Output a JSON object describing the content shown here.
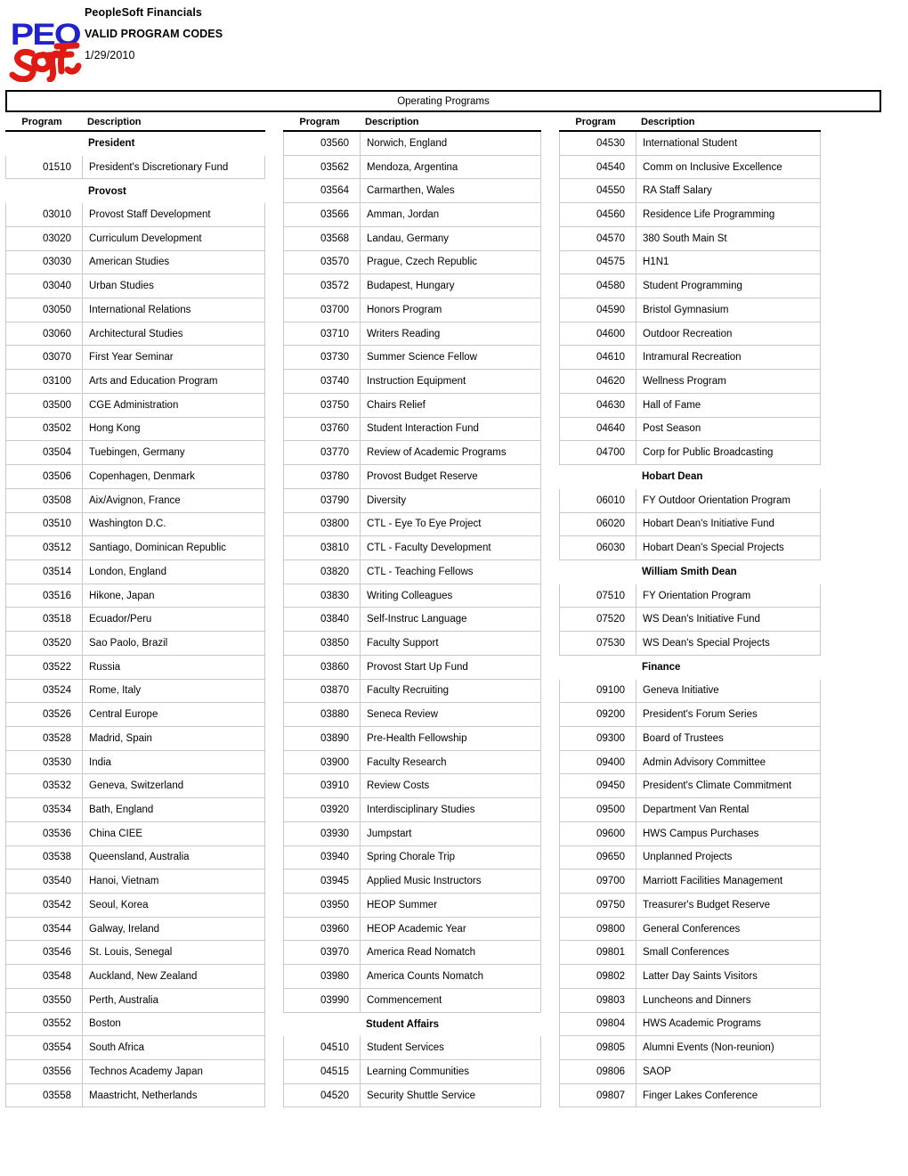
{
  "header": {
    "logo_top_text": "PEOPLE",
    "logo_script_text": "Soft",
    "app_title": "PeopleSoft Financials",
    "report_title": "VALID PROGRAM CODES",
    "report_date": "1/29/2010"
  },
  "table": {
    "title": "Operating Programs",
    "column_headers": {
      "program": "Program",
      "description": "Description"
    },
    "columns": [
      {
        "rows": [
          {
            "type": "section",
            "program": "",
            "description": "President"
          },
          {
            "type": "data",
            "program": "01510",
            "description": "President's Discretionary Fund"
          },
          {
            "type": "section",
            "program": "",
            "description": "Provost"
          },
          {
            "type": "data",
            "program": "03010",
            "description": "Provost Staff Development"
          },
          {
            "type": "data",
            "program": "03020",
            "description": "Curriculum Development"
          },
          {
            "type": "data",
            "program": "03030",
            "description": "American Studies"
          },
          {
            "type": "data",
            "program": "03040",
            "description": "Urban Studies"
          },
          {
            "type": "data",
            "program": "03050",
            "description": "International Relations"
          },
          {
            "type": "data",
            "program": "03060",
            "description": "Architectural Studies"
          },
          {
            "type": "data",
            "program": "03070",
            "description": "First Year Seminar"
          },
          {
            "type": "data",
            "program": "03100",
            "description": "Arts and Education Program"
          },
          {
            "type": "data",
            "program": "03500",
            "description": "CGE Administration"
          },
          {
            "type": "data",
            "program": "03502",
            "description": "Hong Kong"
          },
          {
            "type": "data",
            "program": "03504",
            "description": "Tuebingen, Germany"
          },
          {
            "type": "data",
            "program": "03506",
            "description": "Copenhagen, Denmark"
          },
          {
            "type": "data",
            "program": "03508",
            "description": "Aix/Avignon, France"
          },
          {
            "type": "data",
            "program": "03510",
            "description": "Washington D.C."
          },
          {
            "type": "data",
            "program": "03512",
            "description": "Santiago, Dominican Republic"
          },
          {
            "type": "data",
            "program": "03514",
            "description": "London, England"
          },
          {
            "type": "data",
            "program": "03516",
            "description": "Hikone, Japan"
          },
          {
            "type": "data",
            "program": "03518",
            "description": "Ecuador/Peru"
          },
          {
            "type": "data",
            "program": "03520",
            "description": "Sao Paolo, Brazil"
          },
          {
            "type": "data",
            "program": "03522",
            "description": "Russia"
          },
          {
            "type": "data",
            "program": "03524",
            "description": "Rome, Italy"
          },
          {
            "type": "data",
            "program": "03526",
            "description": "Central Europe"
          },
          {
            "type": "data",
            "program": "03528",
            "description": "Madrid, Spain"
          },
          {
            "type": "data",
            "program": "03530",
            "description": "India"
          },
          {
            "type": "data",
            "program": "03532",
            "description": "Geneva, Switzerland"
          },
          {
            "type": "data",
            "program": "03534",
            "description": "Bath, England"
          },
          {
            "type": "data",
            "program": "03536",
            "description": "China CIEE"
          },
          {
            "type": "data",
            "program": "03538",
            "description": "Queensland, Australia"
          },
          {
            "type": "data",
            "program": "03540",
            "description": "Hanoi, Vietnam"
          },
          {
            "type": "data",
            "program": "03542",
            "description": "Seoul, Korea"
          },
          {
            "type": "data",
            "program": "03544",
            "description": "Galway, Ireland"
          },
          {
            "type": "data",
            "program": "03546",
            "description": "St. Louis, Senegal"
          },
          {
            "type": "data",
            "program": "03548",
            "description": "Auckland, New Zealand"
          },
          {
            "type": "data",
            "program": "03550",
            "description": "Perth, Australia"
          },
          {
            "type": "data",
            "program": "03552",
            "description": "Boston"
          },
          {
            "type": "data",
            "program": "03554",
            "description": "South Africa"
          },
          {
            "type": "data",
            "program": "03556",
            "description": "Technos Academy Japan"
          },
          {
            "type": "data",
            "program": "03558",
            "description": "Maastricht, Netherlands"
          }
        ]
      },
      {
        "rows": [
          {
            "type": "data",
            "program": "03560",
            "description": "Norwich, England"
          },
          {
            "type": "data",
            "program": "03562",
            "description": "Mendoza, Argentina"
          },
          {
            "type": "data",
            "program": "03564",
            "description": "Carmarthen, Wales"
          },
          {
            "type": "data",
            "program": "03566",
            "description": "Amman, Jordan"
          },
          {
            "type": "data",
            "program": "03568",
            "description": "Landau, Germany"
          },
          {
            "type": "data",
            "program": "03570",
            "description": "Prague, Czech Republic"
          },
          {
            "type": "data",
            "program": "03572",
            "description": "Budapest, Hungary"
          },
          {
            "type": "data",
            "program": "03700",
            "description": "Honors Program"
          },
          {
            "type": "data",
            "program": "03710",
            "description": "Writers Reading"
          },
          {
            "type": "data",
            "program": "03730",
            "description": "Summer Science Fellow"
          },
          {
            "type": "data",
            "program": "03740",
            "description": "Instruction Equipment"
          },
          {
            "type": "data",
            "program": "03750",
            "description": "Chairs Relief"
          },
          {
            "type": "data",
            "program": "03760",
            "description": "Student Interaction Fund"
          },
          {
            "type": "data",
            "program": "03770",
            "description": "Review of Academic Programs"
          },
          {
            "type": "data",
            "program": "03780",
            "description": "Provost Budget Reserve"
          },
          {
            "type": "data",
            "program": "03790",
            "description": "Diversity"
          },
          {
            "type": "data",
            "program": "03800",
            "description": "CTL - Eye To Eye Project"
          },
          {
            "type": "data",
            "program": "03810",
            "description": "CTL - Faculty Development"
          },
          {
            "type": "data",
            "program": "03820",
            "description": "CTL - Teaching Fellows"
          },
          {
            "type": "data",
            "program": "03830",
            "description": "Writing Colleagues"
          },
          {
            "type": "data",
            "program": "03840",
            "description": "Self-Instruc Language"
          },
          {
            "type": "data",
            "program": "03850",
            "description": "Faculty Support"
          },
          {
            "type": "data",
            "program": "03860",
            "description": "Provost Start Up Fund"
          },
          {
            "type": "data",
            "program": "03870",
            "description": "Faculty Recruiting"
          },
          {
            "type": "data",
            "program": "03880",
            "description": "Seneca Review"
          },
          {
            "type": "data",
            "program": "03890",
            "description": "Pre-Health Fellowship"
          },
          {
            "type": "data",
            "program": "03900",
            "description": "Faculty Research"
          },
          {
            "type": "data",
            "program": "03910",
            "description": "Review Costs"
          },
          {
            "type": "data",
            "program": "03920",
            "description": "Interdisciplinary Studies"
          },
          {
            "type": "data",
            "program": "03930",
            "description": "Jumpstart"
          },
          {
            "type": "data",
            "program": "03940",
            "description": "Spring Chorale Trip"
          },
          {
            "type": "data",
            "program": "03945",
            "description": "Applied Music Instructors"
          },
          {
            "type": "data",
            "program": "03950",
            "description": "HEOP Summer"
          },
          {
            "type": "data",
            "program": "03960",
            "description": "HEOP Academic Year"
          },
          {
            "type": "data",
            "program": "03970",
            "description": "America Read Nomatch"
          },
          {
            "type": "data",
            "program": "03980",
            "description": "America Counts Nomatch"
          },
          {
            "type": "data",
            "program": "03990",
            "description": "Commencement"
          },
          {
            "type": "section",
            "program": "",
            "description": "Student Affairs"
          },
          {
            "type": "data",
            "program": "04510",
            "description": "Student Services"
          },
          {
            "type": "data",
            "program": "04515",
            "description": "Learning Communities"
          },
          {
            "type": "data",
            "program": "04520",
            "description": "Security Shuttle Service"
          }
        ]
      },
      {
        "rows": [
          {
            "type": "data",
            "program": "04530",
            "description": "International Student"
          },
          {
            "type": "data",
            "program": "04540",
            "description": "Comm on Inclusive Excellence"
          },
          {
            "type": "data",
            "program": "04550",
            "description": "RA Staff Salary"
          },
          {
            "type": "data",
            "program": "04560",
            "description": "Residence Life Programming"
          },
          {
            "type": "data",
            "program": "04570",
            "description": "380 South Main St"
          },
          {
            "type": "data",
            "program": "04575",
            "description": "H1N1"
          },
          {
            "type": "data",
            "program": "04580",
            "description": "Student Programming"
          },
          {
            "type": "data",
            "program": "04590",
            "description": "Bristol Gymnasium"
          },
          {
            "type": "data",
            "program": "04600",
            "description": "Outdoor Recreation"
          },
          {
            "type": "data",
            "program": "04610",
            "description": "Intramural Recreation"
          },
          {
            "type": "data",
            "program": "04620",
            "description": "Wellness Program"
          },
          {
            "type": "data",
            "program": "04630",
            "description": "Hall of Fame"
          },
          {
            "type": "data",
            "program": "04640",
            "description": "Post Season"
          },
          {
            "type": "data",
            "program": "04700",
            "description": "Corp for Public Broadcasting"
          },
          {
            "type": "section",
            "program": "",
            "description": "Hobart Dean"
          },
          {
            "type": "data",
            "program": "06010",
            "description": "FY Outdoor Orientation Program"
          },
          {
            "type": "data",
            "program": "06020",
            "description": "Hobart Dean's Initiative Fund"
          },
          {
            "type": "data",
            "program": "06030",
            "description": "Hobart Dean's Special Projects"
          },
          {
            "type": "section",
            "program": "",
            "description": "William Smith Dean"
          },
          {
            "type": "data",
            "program": "07510",
            "description": "FY Orientation Program"
          },
          {
            "type": "data",
            "program": "07520",
            "description": "WS Dean's Initiative Fund"
          },
          {
            "type": "data",
            "program": "07530",
            "description": "WS Dean's Special Projects"
          },
          {
            "type": "section",
            "program": "",
            "description": "Finance"
          },
          {
            "type": "data",
            "program": "09100",
            "description": "Geneva Initiative"
          },
          {
            "type": "data",
            "program": "09200",
            "description": "President's Forum Series"
          },
          {
            "type": "data",
            "program": "09300",
            "description": "Board of Trustees"
          },
          {
            "type": "data",
            "program": "09400",
            "description": "Admin Advisory Committee"
          },
          {
            "type": "data",
            "program": "09450",
            "description": "President's Climate Commitment"
          },
          {
            "type": "data",
            "program": "09500",
            "description": "Department Van Rental"
          },
          {
            "type": "data",
            "program": "09600",
            "description": "HWS Campus Purchases"
          },
          {
            "type": "data",
            "program": "09650",
            "description": "Unplanned Projects"
          },
          {
            "type": "data",
            "program": "09700",
            "description": "Marriott Facilities Management"
          },
          {
            "type": "data",
            "program": "09750",
            "description": "Treasurer's Budget Reserve"
          },
          {
            "type": "data",
            "program": "09800",
            "description": "General Conferences"
          },
          {
            "type": "data",
            "program": "09801",
            "description": "Small Conferences"
          },
          {
            "type": "data",
            "program": "09802",
            "description": "Latter Day Saints Visitors"
          },
          {
            "type": "data",
            "program": "09803",
            "description": "Luncheons and Dinners"
          },
          {
            "type": "data",
            "program": "09804",
            "description": "HWS Academic Programs"
          },
          {
            "type": "data",
            "program": "09805",
            "description": "Alumni Events (Non-reunion)"
          },
          {
            "type": "data",
            "program": "09806",
            "description": "SAOP"
          },
          {
            "type": "data",
            "program": "09807",
            "description": "Finger Lakes Conference"
          }
        ]
      }
    ]
  },
  "colors": {
    "logo_blue": "#2222CC",
    "logo_red": "#E01B13",
    "grid_line": "#c9c9c9",
    "border": "#000000"
  }
}
